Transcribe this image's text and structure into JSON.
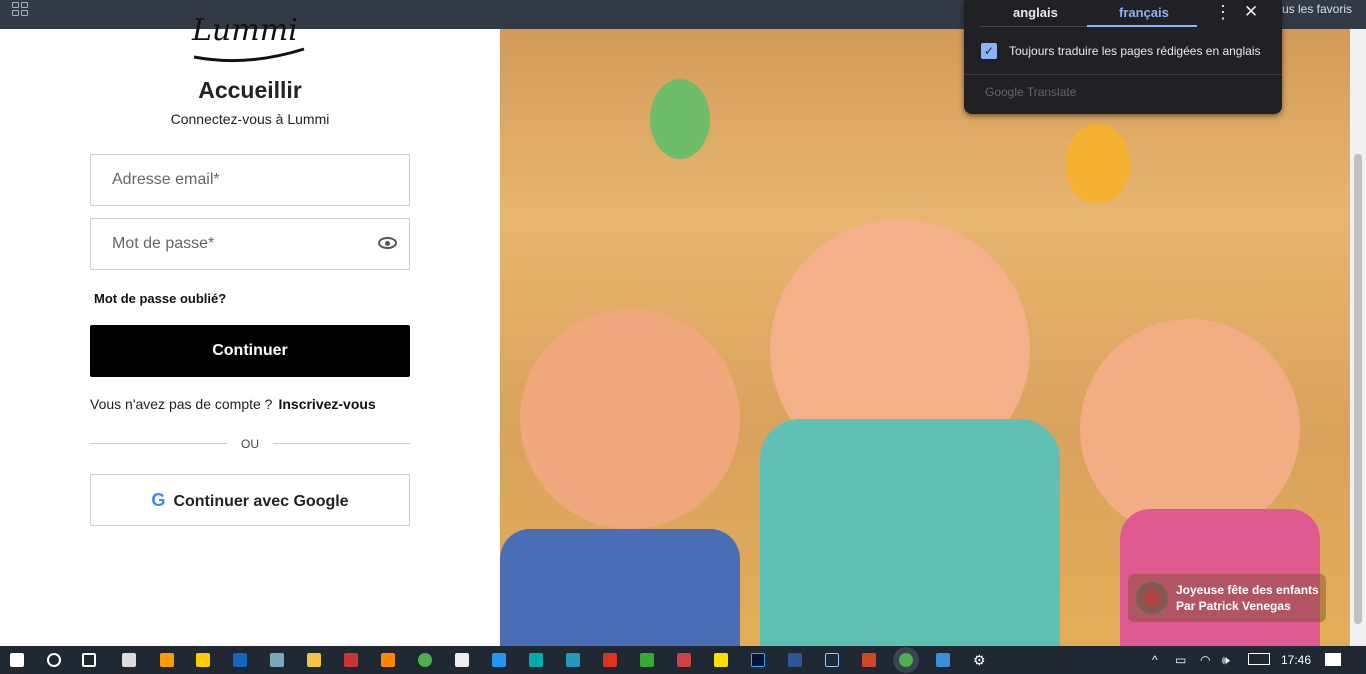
{
  "browser": {
    "bookmarks_label": "ous les favoris"
  },
  "login": {
    "logo_text": "Lummi",
    "title": "Accueillir",
    "subtitle": "Connectez-vous à Lummi",
    "email_placeholder": "Adresse email*",
    "password_placeholder": "Mot de passe*",
    "forgot": "Mot de passe oublié?",
    "continue": "Continuer",
    "no_account": "Vous n'avez pas de compte ?",
    "signup": "Inscrivez-vous",
    "or": "OU",
    "google": "Continuer avec Google",
    "google_icon_glyph": "G"
  },
  "image_caption": {
    "title": "Joyeuse fête des enfants",
    "author": "Par Patrick Venegas"
  },
  "translate": {
    "tab_source": "anglais",
    "tab_target": "français",
    "always_label": "Toujours traduire les pages rédigées en anglais",
    "always_checked": true,
    "footer": "Google Translate"
  },
  "taskbar": {
    "time": "17:46"
  },
  "colors": {
    "accent": "#8ab4f8",
    "topbar": "#323a48",
    "taskbar": "#1f2833"
  }
}
